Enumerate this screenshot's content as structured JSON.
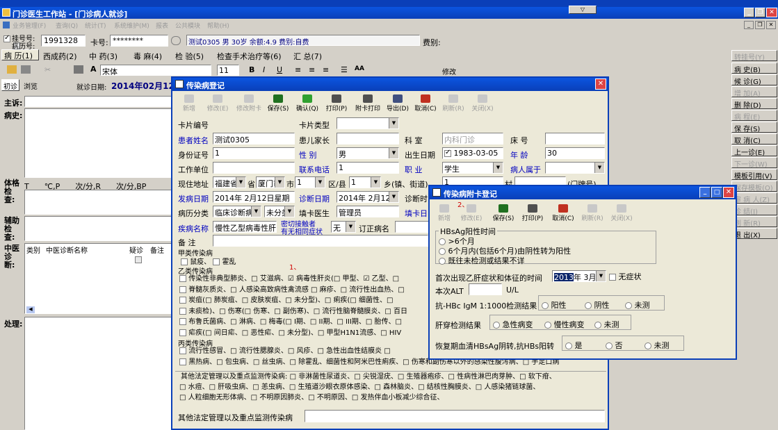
{
  "window": {
    "title": "门诊医生工作站 - [门诊病人就诊]"
  },
  "menu": [
    "业务管理(F)",
    "查询(Q)",
    "统计(T)",
    "系统维护(M)",
    "报表",
    "公共模块",
    "帮助(H)"
  ],
  "patient_bar": {
    "reg_label": "挂号号:",
    "record_label": "病历号:",
    "reg_no": "1991328",
    "card_label": "卡号:",
    "card_value": "********",
    "info": "测试0305 男 30岁 余额:4.9 费别:自费",
    "fee_label": "费别:"
  },
  "main_tabs": [
    "病 历(1)",
    "西成药(2)",
    "中 药(3)",
    "毒 麻(4)",
    "检 验(5)",
    "检查手术治疗等(6)",
    "汇 总(7)"
  ],
  "format_bar": {
    "font": "宋体",
    "size": "11",
    "modify": "修改"
  },
  "visit": {
    "tab1": "初诊",
    "tab2": "浏览",
    "date_label": "就诊日期:",
    "date": "2014年02月12"
  },
  "record": {
    "complaint": "主诉:",
    "history": "病史:",
    "exam": "体格检查:",
    "exam_text": "T____℃,P____次/分,R____次/分,BP_",
    "aux": "辅助检查:",
    "tcm": "中医诊断:",
    "th_type": "类别",
    "th_name": "中医诊断名称",
    "th_doubt": "疑诊",
    "th_note": "备注",
    "treat": "处理:"
  },
  "side_buttons": [
    "转挂号(Y)",
    "病 史(B)",
    "候 诊(G)",
    "增 加(A)",
    "删 除(D)",
    "病 程(E)",
    "保 存(S)",
    "取 消(C)",
    "上一诊(E)",
    "下一诊(W)",
    "模板引用(V)",
    "保存模板(O)",
    "审 病 人(Z)",
    "诊 结(J)",
    "刷 新(R)",
    "退 出(X)"
  ],
  "dialog1": {
    "title": "传染病登记",
    "toolbar": [
      "新增",
      "修改(E)",
      "修改附卡",
      "保存(S)",
      "确认(Q)",
      "打印(P)",
      "附卡打印",
      "导出(D)",
      "取消(C)",
      "刷新(R)",
      "关闭(X)"
    ],
    "labels": {
      "card_no": "卡片编号",
      "card_type": "卡片类型",
      "patient": "患者姓名",
      "parent": "患儿家长",
      "dept": "科 室",
      "bed": "床 号",
      "id_no": "身份证号",
      "sex": "性 别",
      "birth": "出生日期",
      "age": "年 龄",
      "work": "工作单位",
      "phone": "联系电话",
      "job": "职 业",
      "belong": "病人属于",
      "addr": "现住地址",
      "prov": "省",
      "city": "市",
      "district": "区/县",
      "town": "乡(镇、街道)",
      "village": "村",
      "house": "(门牌号)",
      "onset": "发病日期",
      "diag_date": "诊断日期",
      "diag_time": "诊断时",
      "class": "病历分类",
      "doctor": "填卡医生",
      "card_date": "填卡日",
      "disease": "疾病名称",
      "contact1": "密切接触者",
      "contact2": "有无相同症状",
      "revised": "订正病名",
      "remark": "备 注"
    },
    "values": {
      "patient": "测试0305",
      "dept": "内科门诊",
      "id_no": "1",
      "sex": "男",
      "birth": "1983-03-05",
      "age": "30",
      "phone": "1",
      "job": "学生",
      "prov": "福建省",
      "city": "厦门市",
      "district": "1",
      "town": "1",
      "village": "1",
      "onset": "2014年 2月12日星期",
      "diag_date": "2014年 2月12",
      "class": "临床诊断病",
      "class2": "未分类",
      "doctor": "管理员",
      "disease": "慢性乙型病毒性肝",
      "contact": "无"
    },
    "classA": {
      "title": "甲类传染病",
      "items": [
        "鼠疫、",
        "霍乱"
      ]
    },
    "classB": {
      "title": "乙类传染病",
      "lines": [
        "传染性非典型肺炎、□ 艾滋病、☑ 病毒性肝炎(□ 甲型、☑ 乙型、□",
        "脊髓灰质炎、□ 人感染高致病性禽流感 □ 麻疹、□ 流行性出血热、□",
        "炭疽(□ 肺炭疽、□ 皮肤炭疽、□ 未分型)、□ 痢疾(□ 细菌性、□",
        "未痰检)、□ 伤寒(□ 伤寒、□ 副伤寒)、□ 流行性脑脊髓膜炎、□ 百日",
        "布鲁氏菌病、□ 淋病、□ 梅毒(□ I期、□ II期、□ III期、□ 胎传、□",
        "疟疾(□ 间日疟、□ 恶性疟、□ 未分型)、□ 甲型H1N1流感、□ HIV"
      ]
    },
    "classC": {
      "title": "丙类传染病",
      "lines": [
        "流行性感冒、□ 流行性腮腺炎、□ 风疹、□ 急性出血性结膜炎 □",
        "黑热病、□ 包虫病、□ 丝虫病、□ 除霍乱、细菌性和阿米巴性痢疾、□ 伤寒和副伤寒以外的感染性腹泻病、□ 手足口病"
      ]
    },
    "other": {
      "title": "其他法定管理以及重点监测传染病:",
      "lines": [
        "□ 非淋菌性尿道炎、□ 尖锐湿疣、□ 生殖器疱疹、□ 性病性淋巴肉芽肿、□ 软下疳、",
        "□ 水痘、□ 肝吸虫病、□ 恙虫病、□ 生殖道沙眼衣原体感染、□ 森林脑炎、□ 结核性胸膜炎、□ 人感染猪链球菌、",
        "□ 人粒细胞无形体病、□ 不明原因肺炎、□ 不明原因、□ 发热伴血小板减少综合征、"
      ],
      "bottom_label": "其他法定管理以及重点监测传染病"
    },
    "marker1": "1、"
  },
  "dialog2": {
    "title": "传染病附卡登记",
    "marker": "2、",
    "toolbar": [
      "新增",
      "修改(E)",
      "保存(S)",
      "打印(P)",
      "取消(C)",
      "刷新(R)",
      "关闭(X)"
    ],
    "hbs_title": "HBsAg阳性时间",
    "hbs_opts": [
      ">6个月",
      "6个月内(包括6个月)由阴性转为阳性",
      "既往未检测或结果不详"
    ],
    "first_label": "首次出现乙肝症状和体征的时间",
    "first_year": "2013",
    "first_rest": "年 3月",
    "no_symptom": "无症状",
    "alt_label": "本次ALT",
    "alt_unit": "U/L",
    "hbc_label": "抗-HBc IgM 1:1000检测结果",
    "hbc_opts": [
      "阳性",
      "阴性",
      "未测"
    ],
    "liver_label": "肝穿检测结果",
    "liver_opts": [
      "急性病变",
      "慢性病变",
      "未测"
    ],
    "recover_label": "恢复期血清HBsAg阴转,抗HBs阳转",
    "recover_opts": [
      "是",
      "否",
      "未测"
    ]
  }
}
